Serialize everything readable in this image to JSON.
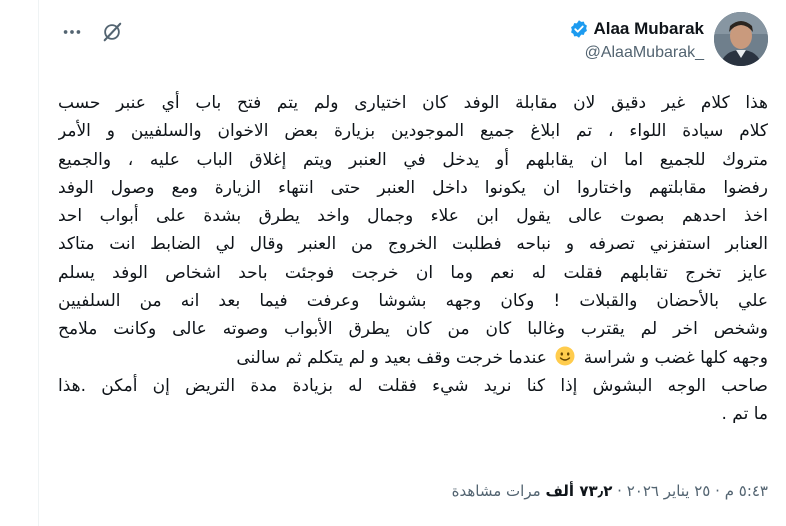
{
  "author": {
    "display_name": "Alaa Mubarak",
    "handle": "@AlaaMubarak_",
    "verified": true
  },
  "header_actions": {
    "grok_icon": "grok-icon",
    "more_icon": "more-options-icon"
  },
  "tweet": {
    "lines": [
      "هذا كلام غير دقيق لان مقابلة  الوفد كان اختيارى ولم يتم فتح باب أي عنبر حسب",
      "كلام سيادة اللواء ، تم ابلاغ جميع الموجودين بزيارة بعض الاخوان والسلفيين و الأمر",
      "متروك للجميع اما ان يقابلهم أو يدخل في العنبر ويتم إغلاق الباب عليه ، والجميع",
      "رفضوا مقابلتهم واختاروا ان يكونوا داخل العنبر حتى انتهاء الزيارة ومع وصول الوفد",
      "اخذ احدهم بصوت عالى يقول ابن علاء وجمال واخد يطرق بشدة على أبواب احد",
      "العنابر استفزني تصرفه و نباحه فطلبت الخروج من العنبر وقال لي الضابط انت متاكد",
      "عايز تخرج تقابلهم فقلت له نعم وما ان خرجت فوجئت باحد اشخاص الوفد يسلم",
      "علي بالأحضان والقبلات ! وكان وجهه بشوشا وعرفت فيما بعد انه من السلفيين",
      "وشخص اخر لم يقترب وغالبا كان من كان يطرق الأبواب وصوته عالى وكانت ملامح",
      "وجهه كلها غضب و شراسة",
      "عندما خرجت وقف بعيد و لم يتكلم ثم سالنى",
      "صاحب الوجه البشوش إذا كنا نريد شيء فقلت له بزيادة مدة التريض إن أمكن .هذا",
      "ما تم ."
    ],
    "emoji_name": "slightly-smiling-face"
  },
  "meta": {
    "time": "٥:٤٣ م",
    "separator": "·",
    "date": "٢٥ يناير ٢٠٢٦",
    "views_count": "٧٣٫٢ ألف",
    "views_label": "مرات مشاهدة"
  },
  "colors": {
    "text_primary": "#0f1419",
    "text_secondary": "#536471",
    "verified_blue": "#1d9bf0",
    "emoji_yellow": "#ffcc4d"
  }
}
